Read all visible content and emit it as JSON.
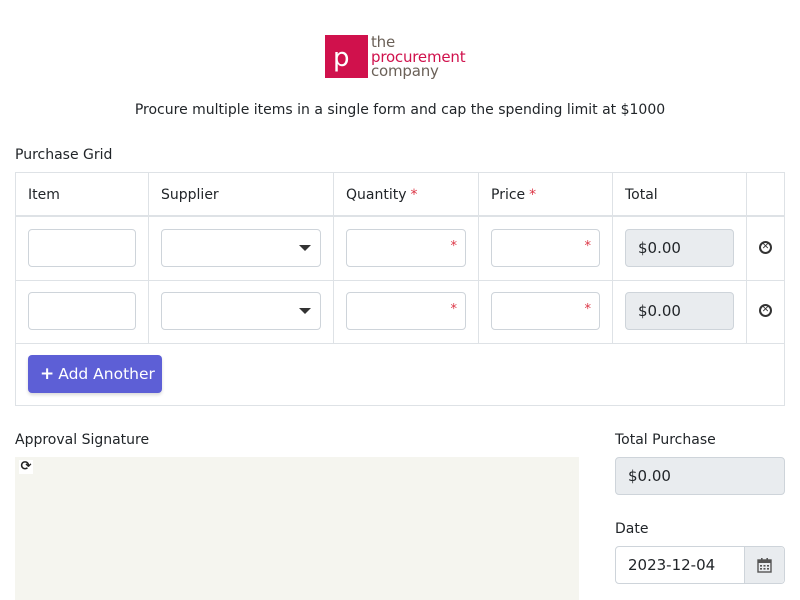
{
  "logo": {
    "letter": "p",
    "line1": "the",
    "line2": "procurement",
    "line3": "company"
  },
  "subtitle": "Procure multiple items in a single form and cap the spending limit at $1000",
  "grid": {
    "label": "Purchase Grid",
    "headers": {
      "item": "Item",
      "supplier": "Supplier",
      "quantity": "Quantity",
      "price": "Price",
      "total": "Total"
    },
    "required_marker": "*",
    "rows": [
      {
        "item": "",
        "supplier": "",
        "quantity": "",
        "price": "",
        "total": "$0.00"
      },
      {
        "item": "",
        "supplier": "",
        "quantity": "",
        "price": "",
        "total": "$0.00"
      }
    ],
    "add_button": "Add Another"
  },
  "signature": {
    "label": "Approval Signature",
    "refresh_icon": "refresh-icon"
  },
  "total_purchase": {
    "label": "Total Purchase",
    "value": "$0.00"
  },
  "date": {
    "label": "Date",
    "value": "2023-12-04",
    "icon": "calendar-icon"
  },
  "colors": {
    "brand": "#d0114c",
    "button": "#5d5fd6",
    "required": "#dc3545"
  }
}
